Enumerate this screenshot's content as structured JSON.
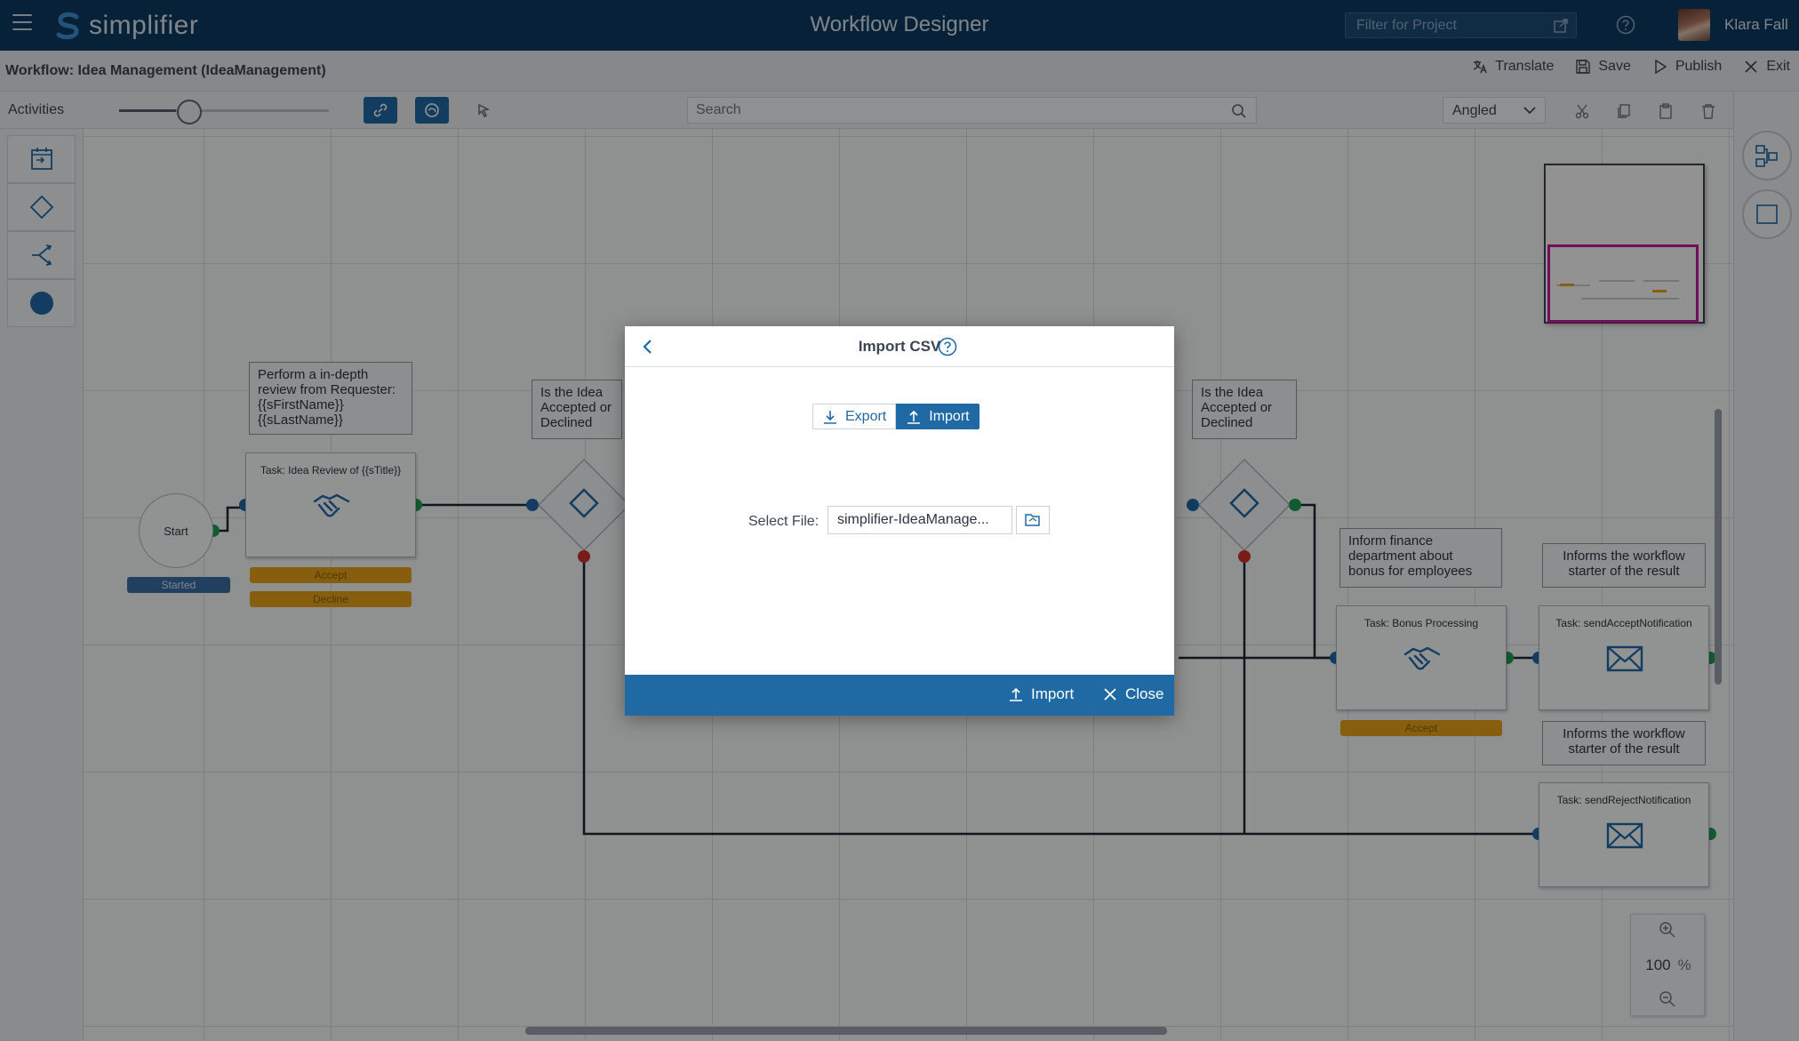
{
  "header": {
    "logo_text": "simplifier",
    "app_title": "Workflow Designer",
    "project_filter_placeholder": "Filter for Project",
    "user_name": "Klara Fall"
  },
  "subheader": {
    "workflow_title": "Workflow: Idea Management (IdeaManagement)",
    "actions": {
      "translate": "Translate",
      "save": "Save",
      "publish": "Publish",
      "exit": "Exit"
    }
  },
  "toolbar": {
    "activities_label": "Activities",
    "zoom_slider_fraction": 0.27,
    "search_placeholder": "Search",
    "route_style": "Angled"
  },
  "palette": {
    "items": [
      "task-icon",
      "gateway-diamond-icon",
      "split-icon",
      "event-circle-icon"
    ]
  },
  "canvas": {
    "start": {
      "label": "Start",
      "status": "Started"
    },
    "notes": {
      "review": [
        "Perform a in-depth",
        "review from Requester:",
        "{{sFirstName}}",
        "{{sLastName}}"
      ],
      "gateway1": [
        "Is the Idea",
        "Accepted or",
        "Declined"
      ],
      "gateway2": [
        "Is the Idea",
        "Accepted or",
        "Declined"
      ],
      "finance": [
        "Inform finance",
        "department about",
        "bonus for employees"
      ],
      "informs1": [
        "Informs the workflow",
        "starter of the result"
      ],
      "informs2": [
        "Informs the workflow",
        "starter of the result"
      ]
    },
    "tasks": {
      "review": {
        "title": "Task: Idea Review of {{sTitle}}",
        "buttons": [
          "Accept",
          "Decline"
        ]
      },
      "bonus": {
        "title": "Task: Bonus Processing",
        "buttons": [
          "Accept"
        ]
      },
      "accept_notify": {
        "title": "Task: sendAcceptNotification"
      },
      "reject_notify": {
        "title": "Task: sendRejectNotification"
      }
    },
    "zoom_value": "100",
    "zoom_unit": "%"
  },
  "dialog": {
    "title": "Import CSV",
    "tabs": {
      "export": "Export",
      "import": "Import"
    },
    "active_tab": "Import",
    "file_label": "Select File:",
    "file_value": "simplifier-IdeaManage...",
    "footer": {
      "import": "Import",
      "close": "Close"
    }
  },
  "colors": {
    "header_bg": "#0d3a63",
    "accent": "#1f6aa5",
    "task_button": "#e8a317",
    "status_badge": "#3a6fa6",
    "port_green": "#1f9d55",
    "port_blue": "#1f6aa5",
    "port_red": "#d0312d",
    "minimap_viewport": "#c5179d"
  }
}
